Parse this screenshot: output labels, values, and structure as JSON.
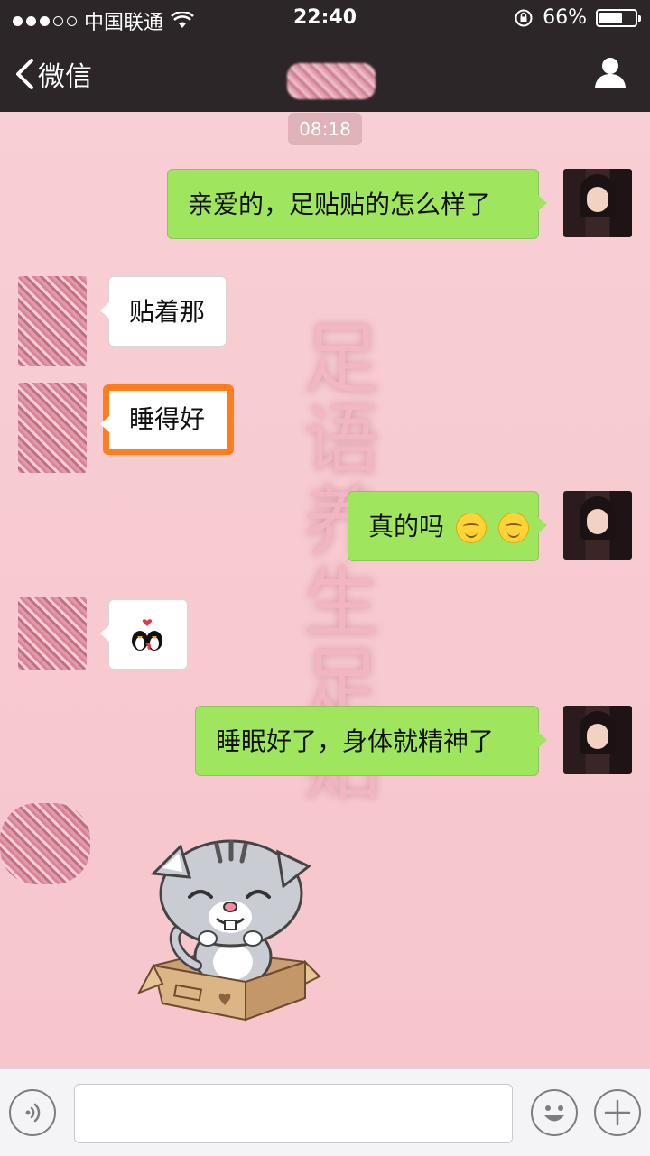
{
  "status_bar": {
    "carrier": "中国联通",
    "time": "22:40",
    "battery_text": "66%",
    "battery_level": 0.66,
    "signal_bars_filled": 3,
    "signal_bars_total": 5
  },
  "nav": {
    "back_label": "微信"
  },
  "chat": {
    "timestamp": "08:18",
    "watermark": "足语养生足贴",
    "messages": [
      {
        "side": "right",
        "text": "亲爱的，足贴贴的怎么样了"
      },
      {
        "side": "left",
        "text": "贴着那"
      },
      {
        "side": "left",
        "text": "睡得好"
      },
      {
        "side": "right",
        "text": "真的吗"
      },
      {
        "side": "left",
        "text": ""
      },
      {
        "side": "right",
        "text": "睡眠好了，身体就精神了"
      }
    ]
  },
  "icons": [
    "back-chevron-icon",
    "profile-icon",
    "wifi-icon",
    "rotation-lock-icon",
    "voice-icon",
    "emoji-icon",
    "plus-icon"
  ],
  "colors": {
    "header_bg": "#2c2628",
    "chat_bg": "#f6c9cf",
    "bubble_green": "#9fe65e",
    "highlight_orange": "#ff7d1c"
  }
}
